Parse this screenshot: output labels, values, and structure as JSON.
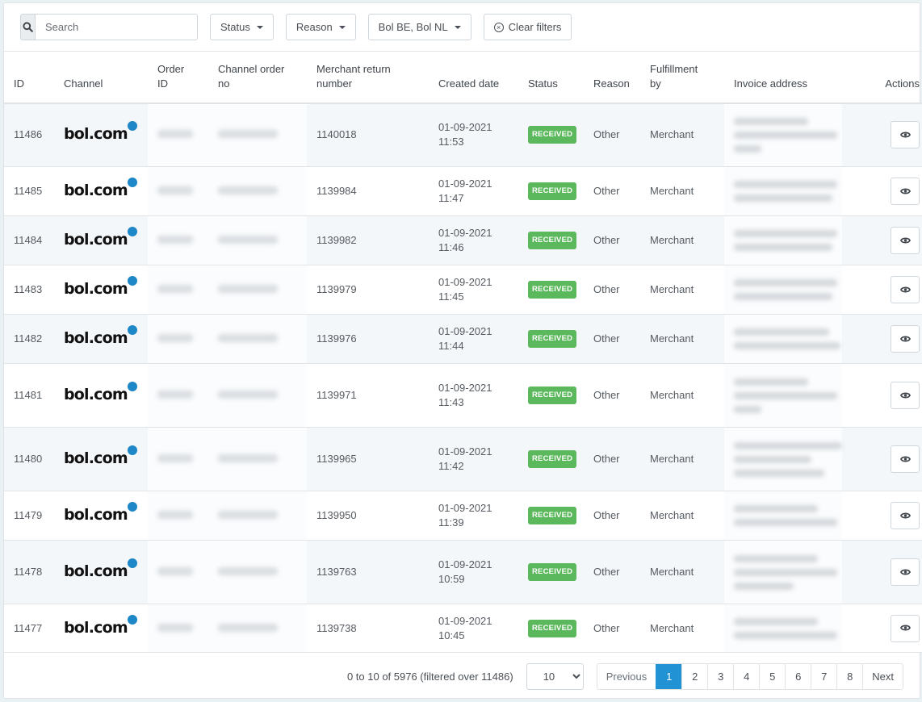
{
  "toolbar": {
    "search_icon": "search-icon",
    "search_placeholder": "Search",
    "search_value": "",
    "status_label": "Status",
    "reason_label": "Reason",
    "channels_label": "Bol BE, Bol NL",
    "clear_label": "Clear filters",
    "clear_icon": "circle-x-icon"
  },
  "table": {
    "headers": {
      "id": "ID",
      "channel": "Channel",
      "order_id_1": "Order",
      "order_id_2": "ID",
      "channel_order_1": "Channel order",
      "channel_order_2": "no",
      "merchant_return_1": "Merchant return",
      "merchant_return_2": "number",
      "created": "Created date",
      "status": "Status",
      "reason": "Reason",
      "fulfillment_1": "Fulfillment",
      "fulfillment_2": "by",
      "invoice": "Invoice address",
      "actions": "Actions"
    },
    "channel_logo": "bol.com",
    "rows": [
      {
        "id": "11486",
        "merchant_return": "1140018",
        "date": "01-09-2021",
        "time": "11:53",
        "status": "RECEIVED",
        "reason": "Other",
        "fulfillment": "Merchant",
        "address_lines": 3
      },
      {
        "id": "11485",
        "merchant_return": "1139984",
        "date": "01-09-2021",
        "time": "11:47",
        "status": "RECEIVED",
        "reason": "Other",
        "fulfillment": "Merchant",
        "address_lines": 2
      },
      {
        "id": "11484",
        "merchant_return": "1139982",
        "date": "01-09-2021",
        "time": "11:46",
        "status": "RECEIVED",
        "reason": "Other",
        "fulfillment": "Merchant",
        "address_lines": 2
      },
      {
        "id": "11483",
        "merchant_return": "1139979",
        "date": "01-09-2021",
        "time": "11:45",
        "status": "RECEIVED",
        "reason": "Other",
        "fulfillment": "Merchant",
        "address_lines": 2
      },
      {
        "id": "11482",
        "merchant_return": "1139976",
        "date": "01-09-2021",
        "time": "11:44",
        "status": "RECEIVED",
        "reason": "Other",
        "fulfillment": "Merchant",
        "address_lines": 2
      },
      {
        "id": "11481",
        "merchant_return": "1139971",
        "date": "01-09-2021",
        "time": "11:43",
        "status": "RECEIVED",
        "reason": "Other",
        "fulfillment": "Merchant",
        "address_lines": 3
      },
      {
        "id": "11480",
        "merchant_return": "1139965",
        "date": "01-09-2021",
        "time": "11:42",
        "status": "RECEIVED",
        "reason": "Other",
        "fulfillment": "Merchant",
        "address_lines": 3
      },
      {
        "id": "11479",
        "merchant_return": "1139950",
        "date": "01-09-2021",
        "time": "11:39",
        "status": "RECEIVED",
        "reason": "Other",
        "fulfillment": "Merchant",
        "address_lines": 2
      },
      {
        "id": "11478",
        "merchant_return": "1139763",
        "date": "01-09-2021",
        "time": "10:59",
        "status": "RECEIVED",
        "reason": "Other",
        "fulfillment": "Merchant",
        "address_lines": 3
      },
      {
        "id": "11477",
        "merchant_return": "1139738",
        "date": "01-09-2021",
        "time": "10:45",
        "status": "RECEIVED",
        "reason": "Other",
        "fulfillment": "Merchant",
        "address_lines": 2
      }
    ],
    "view_icon": "eye-icon"
  },
  "footer": {
    "info": "0 to 10 of 5976 (filtered over 11486)",
    "page_size": "10",
    "previous": "Previous",
    "next": "Next",
    "pages": [
      "1",
      "2",
      "3",
      "4",
      "5",
      "6",
      "7",
      "8"
    ],
    "active_page": "1"
  },
  "colors": {
    "status_received": "#5cb85c",
    "pagination_active": "#2192d4",
    "bol_logo_dot": "#1e87c7"
  }
}
